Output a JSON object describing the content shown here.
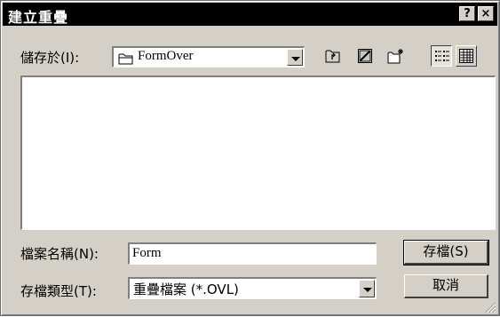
{
  "window": {
    "title": "建立重疊",
    "help_button": "?",
    "close_button": "×"
  },
  "save_in": {
    "label": "儲存於(I):",
    "folder": "FormOver"
  },
  "toolbar": {
    "icons": [
      "up-one-level-icon",
      "desktop-icon",
      "new-folder-icon",
      "list-view-icon",
      "details-view-icon"
    ]
  },
  "file_name": {
    "label": "檔案名稱(N):",
    "value": "Form"
  },
  "file_type": {
    "label": "存檔類型(T):",
    "value": "重疊檔案 (*.OVL)"
  },
  "buttons": {
    "save": "存檔(S)",
    "cancel": "取消"
  }
}
